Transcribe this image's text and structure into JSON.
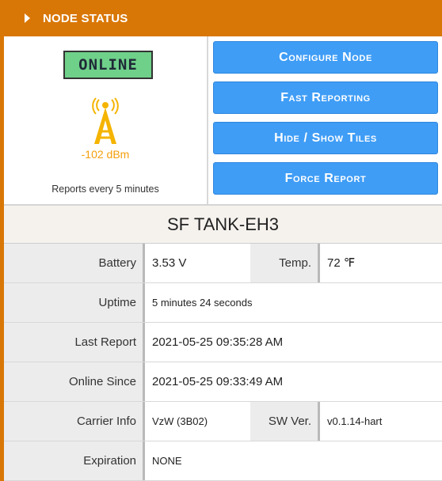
{
  "header": {
    "title": "NODE STATUS"
  },
  "status": {
    "badge": "ONLINE",
    "badge_color": "#6fd08a",
    "signal": "-102 dBm",
    "signal_icon": "cell-tower-icon",
    "signal_color": "#f59e0b",
    "report_interval": "Reports every 5 minutes"
  },
  "actions": {
    "configure": "Configure Node",
    "fast_reporting": "Fast Reporting",
    "hide_show_tiles": "Hide / Show Tiles",
    "force_report": "Force Report"
  },
  "node": {
    "name": "SF TANK-EH3"
  },
  "info": {
    "battery_label": "Battery",
    "battery_value": "3.53 V",
    "temp_label": "Temp.",
    "temp_value": "72 ℉",
    "uptime_label": "Uptime",
    "uptime_value": "5 minutes 24 seconds",
    "last_report_label": "Last Report",
    "last_report_value": "2021-05-25 09:35:28 AM",
    "online_since_label": "Online Since",
    "online_since_value": "2021-05-25 09:33:49 AM",
    "carrier_label": "Carrier Info",
    "carrier_value": "VzW (3B02)",
    "sw_label": "SW Ver.",
    "sw_value": "v0.1.14-hart",
    "expiration_label": "Expiration",
    "expiration_value": "NONE"
  },
  "theme": {
    "accent": "#d97706",
    "button": "#3f9df6"
  }
}
